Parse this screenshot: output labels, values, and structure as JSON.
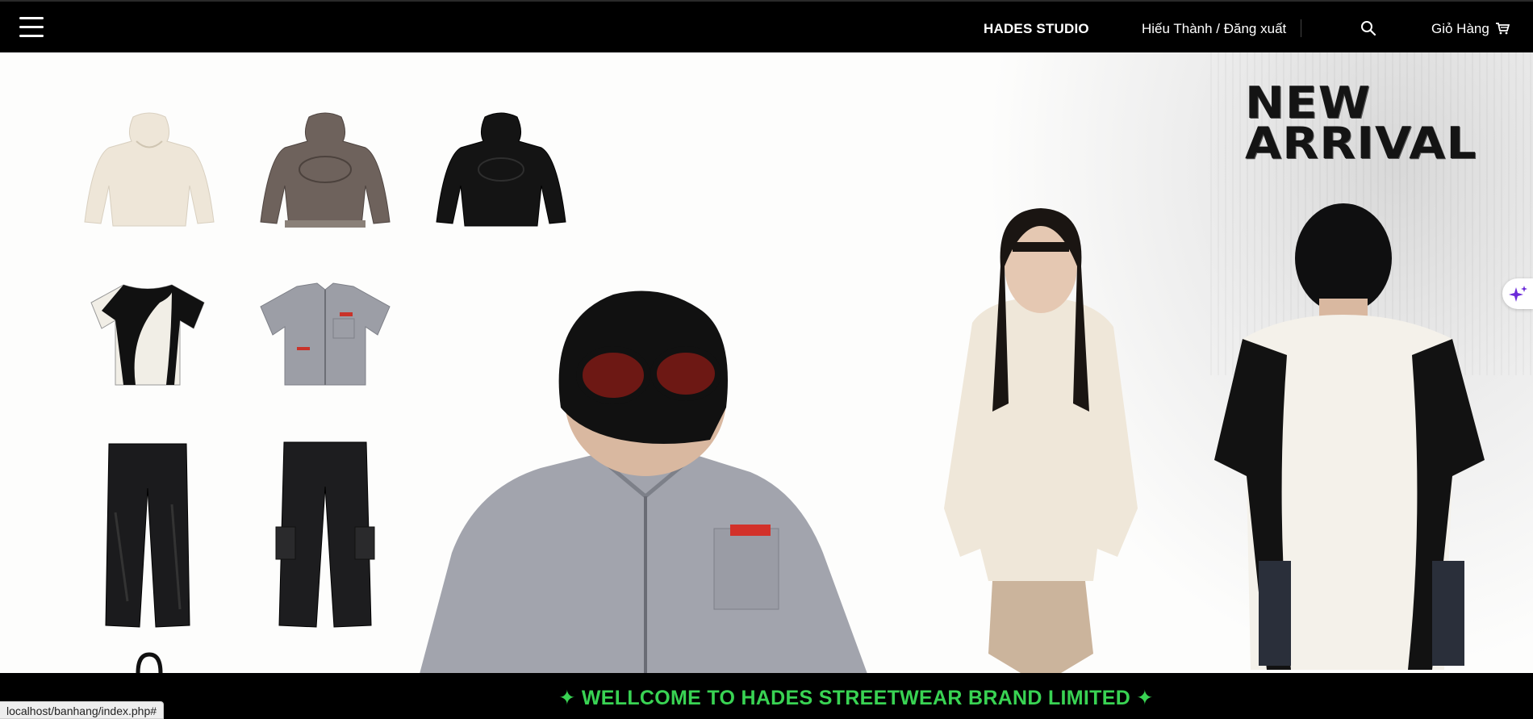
{
  "nav": {
    "menu_icon": "hamburger-icon",
    "brand": "HADES STUDIO",
    "user": "Hiếu Thành / Đăng xuất",
    "search_icon": "search-icon",
    "cart_label": "Giỏ Hàng",
    "cart_icon": "cart-icon"
  },
  "hero": {
    "headline_line1": "NEW",
    "headline_line2": "ARRIVAL"
  },
  "footer": {
    "marquee": "✦ WELLCOME TO HADES STREETWEAR BRAND LIMITED ✦"
  },
  "status_url": "localhost/banhang/index.php#",
  "colors": {
    "nav_bg": "#000000",
    "welcome_green": "#39d353",
    "sparkle_purple": "#6b2bd9"
  }
}
